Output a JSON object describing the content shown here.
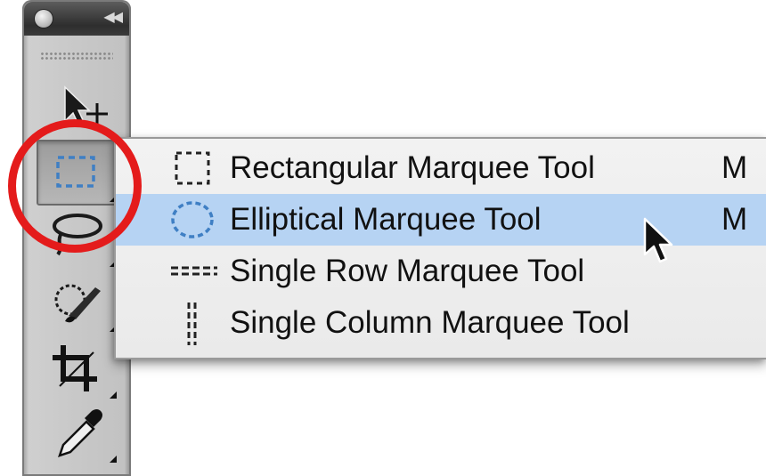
{
  "toolbar": {
    "tools": [
      {
        "name": "move-tool",
        "icon": "move-arrow-icon"
      },
      {
        "name": "marquee-tool",
        "icon": "rectangular-marquee-icon",
        "active": true
      },
      {
        "name": "lasso-tool",
        "icon": "lasso-icon"
      },
      {
        "name": "quick-selection-tool",
        "icon": "quick-selection-brush-icon"
      },
      {
        "name": "crop-tool",
        "icon": "crop-icon"
      },
      {
        "name": "eyedropper-tool",
        "icon": "eyedropper-icon"
      }
    ],
    "collapse_glyph": "◀◀"
  },
  "flyout": {
    "items": [
      {
        "label": "Rectangular Marquee Tool",
        "shortcut": "M",
        "icon": "rectangular-marquee-icon"
      },
      {
        "label": "Elliptical Marquee Tool",
        "shortcut": "M",
        "icon": "elliptical-marquee-icon",
        "selected": true
      },
      {
        "label": "Single Row Marquee Tool",
        "shortcut": "",
        "icon": "single-row-marquee-icon"
      },
      {
        "label": "Single Column Marquee Tool",
        "shortcut": "",
        "icon": "single-column-marquee-icon"
      }
    ]
  },
  "colors": {
    "highlight_ring": "#e41b1b",
    "selected_row": "#b6d3f3",
    "marquee_blue": "#3f7fc4"
  }
}
